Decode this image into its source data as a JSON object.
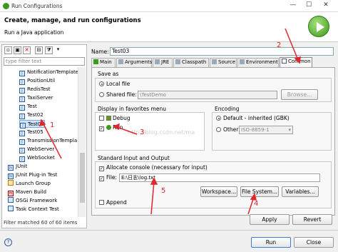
{
  "window": {
    "title": "Run Configurations",
    "controls": [
      "—",
      "☐",
      "✕"
    ]
  },
  "header": {
    "title": "Create, manage, and run configurations",
    "subtitle": "Run a Java application"
  },
  "left": {
    "filter_placeholder": "type filter text",
    "tree": [
      "NotificationTemplate",
      "PositionUtil",
      "RedisTest",
      "TaxiServer",
      "Test",
      "Test02",
      "Test03",
      "Test05",
      "TransmissionTempla",
      "WebServer",
      "WebSocket",
      "JUnit",
      "JUnit Plug-in Test",
      "Launch Group",
      "Maven Build",
      "OSGi Framework",
      "Task Context Test"
    ],
    "selected": "Test03",
    "status": "Filter matched 60 of 60 items"
  },
  "name": {
    "label": "Name:",
    "value": "Test03"
  },
  "tabs": [
    "Main",
    "Arguments",
    "JRE",
    "Classpath",
    "Source",
    "Environment",
    "Common"
  ],
  "active_tab": "Common",
  "save_as": {
    "title": "Save as",
    "local": "Local file",
    "shared": "Shared file:",
    "shared_value": "\\TestDemo",
    "browse": "Browse..."
  },
  "favorites": {
    "title": "Display in favorites menu",
    "debug": "Debug",
    "run": "Run"
  },
  "encoding": {
    "title": "Encoding",
    "default": "Default - inherited (GBK)",
    "other": "Other",
    "other_value": "ISO-8859-1"
  },
  "stdio": {
    "title": "Standard Input and Output",
    "allocate": "Allocate console (necessary for input)",
    "file_label": "File:",
    "file_value": "E:\\日志\\log.txt",
    "workspace": "Workspace...",
    "filesystem": "File System...",
    "variables": "Variables...",
    "append": "Append"
  },
  "buttons": {
    "apply": "Apply",
    "revert": "Revert",
    "run": "Run",
    "close": "Close"
  },
  "annotations": [
    "1",
    "2",
    "3",
    "4",
    "5"
  ],
  "watermark": "http://blog.csdn.net/ma"
}
